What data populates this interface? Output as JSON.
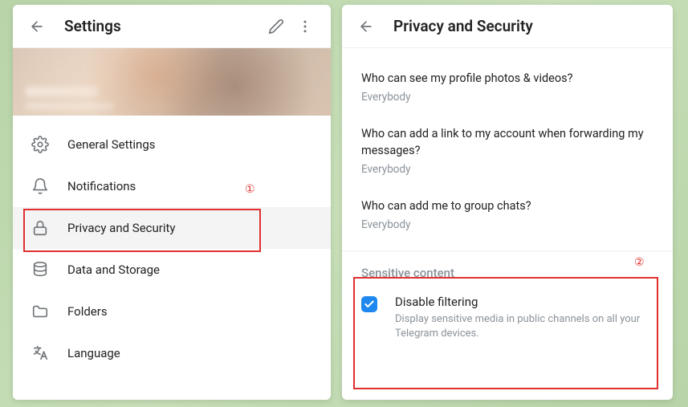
{
  "left": {
    "title": "Settings",
    "items": [
      {
        "icon": "gear-icon",
        "label": "General Settings"
      },
      {
        "icon": "bell-icon",
        "label": "Notifications"
      },
      {
        "icon": "lock-icon",
        "label": "Privacy and Security"
      },
      {
        "icon": "database-icon",
        "label": "Data and Storage"
      },
      {
        "icon": "folder-icon",
        "label": "Folders"
      },
      {
        "icon": "language-icon",
        "label": "Language"
      }
    ]
  },
  "right": {
    "title": "Privacy and Security",
    "privacy": [
      {
        "question": "Who can see my profile photos & videos?",
        "answer": "Everybody"
      },
      {
        "question": "Who can add a link to my account when forwarding my messages?",
        "answer": "Everybody"
      },
      {
        "question": "Who can add me to group chats?",
        "answer": "Everybody"
      }
    ],
    "sectionTitle": "Sensitive content",
    "checkbox": {
      "title": "Disable filtering",
      "desc": "Display sensitive media in public channels on all your Telegram devices.",
      "checked": true
    }
  },
  "annotations": {
    "label1": "①",
    "label2": "②"
  }
}
